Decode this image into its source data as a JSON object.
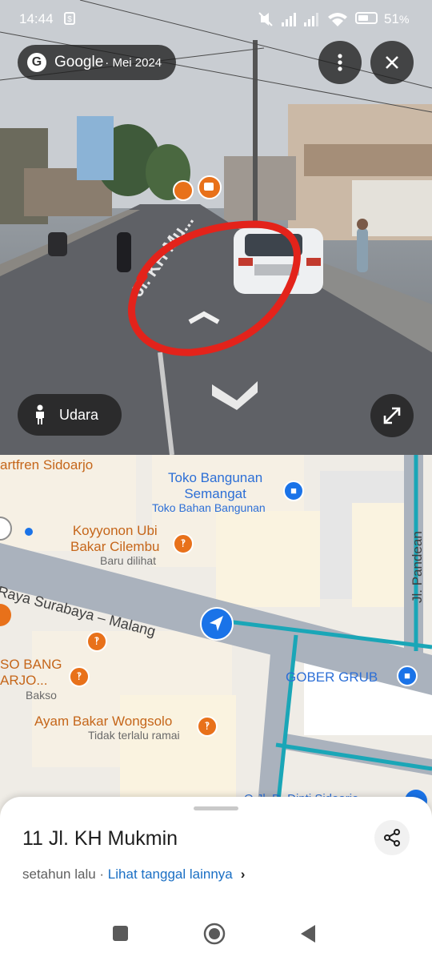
{
  "status_bar": {
    "time": "14:44",
    "notification_icon": "shopping-bag-icon",
    "battery_percent": "51",
    "battery_suffix": "%",
    "icons": [
      "mute-icon",
      "signal-icon",
      "signal-icon",
      "wifi-icon",
      "battery-icon"
    ]
  },
  "street_view": {
    "brand": "Google",
    "date": "· Mei 2024",
    "street_label": "Jl. KH Mu...",
    "menu_icon": "more-vert-icon",
    "close_icon": "close-icon",
    "aerial_button_label": "Udara",
    "aerial_icon": "person-icon",
    "expand_icon": "expand-icon",
    "annotation_color": "#e3231b"
  },
  "map": {
    "labels": {
      "smartfren": "artfren Sidoarjo",
      "toko_name_1": "Toko Bangunan",
      "toko_name_2": "Semangat",
      "toko_sub": "Toko Bahan Bangunan",
      "koyyonon_1": "Koyyonon Ubi",
      "koyyonon_2": "Bakar Cilembu",
      "koyyonon_sub": "Baru dilihat",
      "road_main": "Raya Surabaya – Malang",
      "road_pandean": "Jl. Pandean",
      "bakso_1": "SO BANG",
      "bakso_2": "ARJO...",
      "bakso_sub": "Bakso",
      "ayam": "Ayam Bakar Wongsolo",
      "ayam_sub": "Tidak terlalu ramai",
      "gober": "GOBER GRUB",
      "bottom_cut": "O  Jl. D. Dipti Sidoarjo"
    },
    "colors": {
      "poi_orange": "#e8711a",
      "poi_blue": "#2d6fd6",
      "route_teal": "#1aa6b7",
      "road_gray": "#aab2bd"
    }
  },
  "sheet": {
    "address": "11 Jl. KH Mukmin",
    "relative_time": "setahun lalu",
    "separator": " · ",
    "other_dates_link": "Lihat tanggal lainnya",
    "chevron": "›",
    "share_icon": "share-icon"
  },
  "nav_bar": {
    "icons": [
      "recents-square-icon",
      "home-circle-icon",
      "back-triangle-icon"
    ]
  }
}
